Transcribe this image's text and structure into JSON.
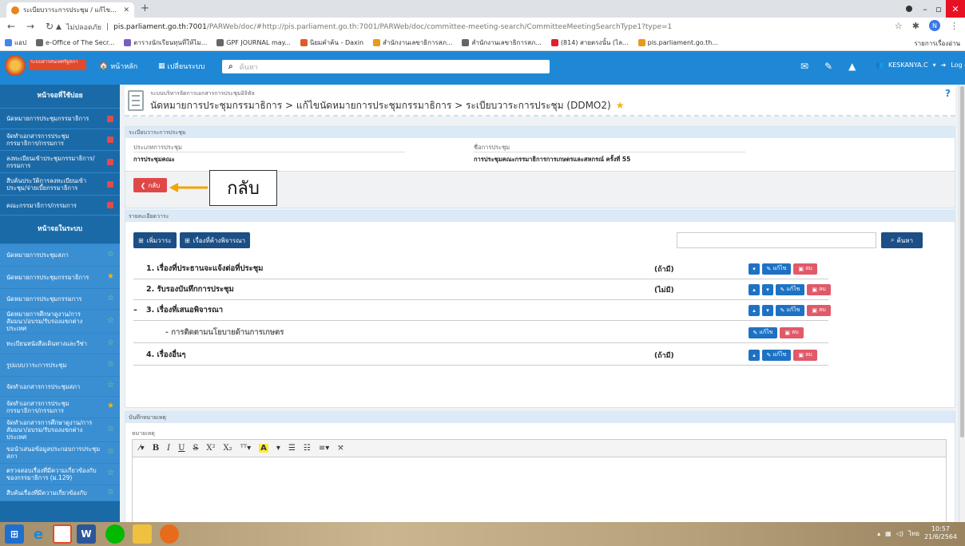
{
  "browser": {
    "tab_title": "ระเบียบวาระการประชุม / แก้ไขนัดหมายฯ",
    "url_warning": "ไม่ปลอดภัย",
    "url_host": "pis.parliament.go.th:7001",
    "url_path": "/PARWeb/doc/#http://pis.parliament.go.th:7001/PARWeb/doc/committee-meeting-search/CommitteeMeetingSearchType1?type=1",
    "profile_initial": "N",
    "bookmarks": [
      {
        "label": "แอป",
        "color": "#4285f4"
      },
      {
        "label": "e-Office of The Secr...",
        "color": "#666666"
      },
      {
        "label": "ตารางนักเรียนทุนที่ให้ไม...",
        "color": "#7a5cc7"
      },
      {
        "label": "GPF JOURNAL may...",
        "color": "#666666"
      },
      {
        "label": "นิยมคำค้น - Daxin",
        "color": "#e05a2a"
      },
      {
        "label": "สำนักงานเลขาธิการสภ...",
        "color": "#e89a1b"
      },
      {
        "label": "สำนักงานเลขาธิการสภ...",
        "color": "#666666"
      },
      {
        "label": "(814) สายตรงนั้น (ไล...",
        "color": "#e0202a"
      },
      {
        "label": "pis.parliament.go.th...",
        "color": "#e89a1b"
      }
    ],
    "reading_list": "รายการเรื่องอ่าน"
  },
  "header": {
    "logo_text": "ระบบสารสนเทศรัฐสภา",
    "home_label": "หน้าหลัก",
    "switch_label": "เปลี่ยนระบบ",
    "search_placeholder": "ค้นหา",
    "username": "KESKANYA.C",
    "logout_label": "Log out"
  },
  "sidebar": {
    "sections": [
      {
        "label": "หน้าจอที่ใช้บ่อย",
        "type": "head",
        "h": 30
      },
      {
        "label": "นัดหมายการประชุมกรรมาธิการ",
        "type": "item",
        "marker": "badge",
        "h": 26
      },
      {
        "label": "จัดทำเอกสารการประชุมกรรมาธิการ/กรรมการ",
        "type": "item",
        "marker": "badge",
        "h": 27
      },
      {
        "label": "ลงทะเบียนเข้าประชุมกรรมาธิการ/กรรมการ",
        "type": "item",
        "marker": "badge",
        "h": 28
      },
      {
        "label": "สืบค้นประวัติการลงทะเบียนเข้าประชุม/จ่ายเบี้ยกรรมาธิการ",
        "type": "item",
        "marker": "badge",
        "h": 28
      },
      {
        "label": "คณะกรรมาธิการ/กรรมการ",
        "type": "item",
        "marker": "badge",
        "h": 25
      },
      {
        "label": "หน้าจอในระบบ",
        "type": "head",
        "h": 36
      },
      {
        "label": "นัดหมายการประชุมสภา",
        "type": "sub",
        "marker": "star",
        "h": 28
      },
      {
        "label": "นัดหมายการประชุมกรรมาธิการ",
        "type": "sub",
        "marker": "star-gold",
        "h": 28
      },
      {
        "label": "นัดหมายการประชุมกรรมการ",
        "type": "sub",
        "marker": "star",
        "h": 26
      },
      {
        "label": "นัดหมายการศึกษาดูงาน/การสัมมนา/อบรม/รับรองแขกต่างประเทศ",
        "type": "sub",
        "marker": "star",
        "h": 30
      },
      {
        "label": "ทะเบียนหนังสือเดินทางและวีซ่า",
        "type": "sub",
        "marker": "star",
        "h": 26
      },
      {
        "label": "รูปแบบวาระการประชุม",
        "type": "sub",
        "marker": "star",
        "h": 28
      },
      {
        "label": "จัดทำเอกสารการประชุมสภา",
        "type": "sub",
        "marker": "star",
        "h": 25
      },
      {
        "label": "จัดทำเอกสารการประชุมกรรมาธิการ/กรรมการ",
        "type": "sub",
        "marker": "star-gold",
        "h": 27
      },
      {
        "label": "จัดทำเอกสารการศึกษาดูงาน/การสัมมนา/อบรม/รับรองแขกต่างประเทศ",
        "type": "sub",
        "marker": "star",
        "h": 30
      },
      {
        "label": "ขอนำเสนอข้อมูลประกอบการประชุมสภา",
        "type": "sub",
        "marker": "star",
        "h": 27
      },
      {
        "label": "ตรวจสอบเรื่องที่มีความเกี่ยวข้องกับของกรรมาธิการ (ม.129)",
        "type": "sub",
        "marker": "star",
        "h": 27
      },
      {
        "label": "สืบค้นเรื่องที่มีความเกี่ยวข้องกับ",
        "type": "sub",
        "marker": "star",
        "h": 20
      }
    ]
  },
  "page": {
    "system_name": "ระบบบริหารจัดการเอกสารการประชุมอิจิทัล",
    "breadcrumb": "นัดหมายการประชุมกรรมาธิการ > แก้ไขนัดหมายการประชุมกรรมาธิการ > ระเบียบวาระการประชุม (DDMO2)",
    "help": "?",
    "agenda_panel_title": "ระเบียบวาระการประชุม",
    "meeting_type_label": "ประเภทการประชุม",
    "meeting_type_value": "การประชุมคณะ",
    "meeting_name_label": "ชื่อการประชุม",
    "meeting_name_value": "การประชุมคณะกรรมาธิการการเกษตรและสหกรณ์ ครั้งที่ 55",
    "back_button": "กลับ",
    "annotation": "กลับ",
    "detail_panel_title": "รายละเอียดวาระ",
    "add_agenda_button": "เพิ่มวาระ",
    "pending_button": "เรื่องที่ค้างพิจารณา",
    "search_button": "ค้นหา",
    "agenda_items": [
      {
        "label": "1. เรื่องที่ประธานจะแจ้งต่อที่ประชุม",
        "optional": "(ถ้ามี)",
        "actions": [
          "down",
          "edit",
          "delete"
        ],
        "sub": false,
        "dash": false
      },
      {
        "label": "2. รับรองบันทึกการประชุม",
        "optional": "(ไม่มี)",
        "actions": [
          "up",
          "down",
          "edit",
          "delete"
        ],
        "sub": false,
        "dash": false
      },
      {
        "label": "3. เรื่องที่เสนอพิจารณา",
        "optional": "",
        "actions": [
          "up",
          "down",
          "edit",
          "delete"
        ],
        "sub": false,
        "dash": true
      },
      {
        "label": "- การติดตามนโยบายด้านการเกษตร",
        "optional": "",
        "actions": [
          "edit",
          "delete"
        ],
        "sub": true,
        "dash": false
      },
      {
        "label": "4. เรื่องอื่นๆ",
        "optional": "(ถ้ามี)",
        "actions": [
          "up",
          "edit",
          "delete"
        ],
        "sub": false,
        "dash": false
      }
    ],
    "edit_label": "แก้ไข",
    "delete_label": "ลบ",
    "notes_panel_title": "บันทึกหมายเหตุ",
    "notes_label": "หมายเหตุ"
  },
  "taskbar": {
    "clock_time": "10:57",
    "clock_date": "21/6/2564",
    "lang": "ไทย"
  },
  "colors": {
    "header_blue": "#1e88d6",
    "sidebar_blue": "#1b6aa8",
    "button_navy": "#1b4f86",
    "danger_red": "#e04848",
    "star_gold": "#f5b50a"
  }
}
